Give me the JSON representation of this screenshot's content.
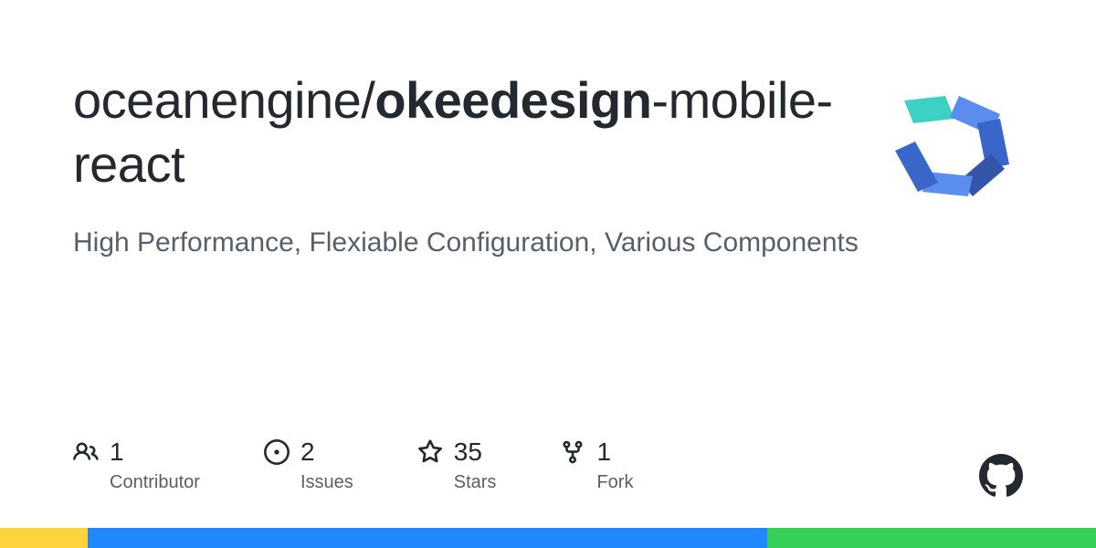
{
  "repo": {
    "owner": "oceanengine",
    "separator": "/",
    "name_bold": "okeedesign",
    "name_rest": "-mobile-react"
  },
  "description": "High Performance, Flexiable Configuration, Various Components",
  "stats": {
    "contributors": {
      "count": "1",
      "label": "Contributor"
    },
    "issues": {
      "count": "2",
      "label": "Issues"
    },
    "stars": {
      "count": "35",
      "label": "Stars"
    },
    "forks": {
      "count": "1",
      "label": "Fork"
    }
  },
  "colors": {
    "bar1": "#ffd33d",
    "bar2": "#2188ff",
    "bar3": "#34d058"
  }
}
